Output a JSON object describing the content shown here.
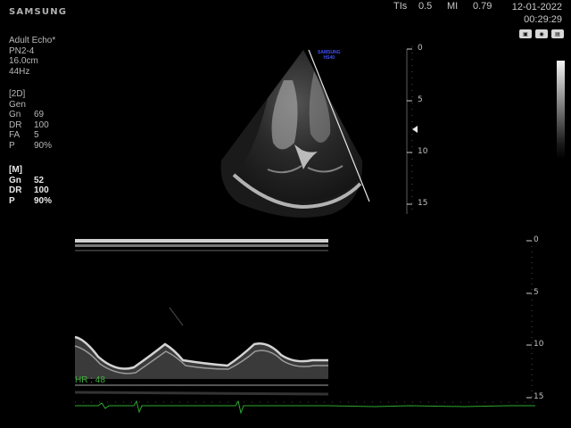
{
  "header": {
    "brand": "SAMSUNG",
    "tis_label": "TIs",
    "tis_value": "0.5",
    "mi_label": "MI",
    "mi_value": "0.79",
    "date": "12-01-2022",
    "time": "00:29:29"
  },
  "exam": {
    "preset": "Adult Echo*",
    "probe": "PN2-4",
    "depth": "16.0cm",
    "frame_rate": "44Hz"
  },
  "mode_2d": {
    "title": "[2D]",
    "mode": "Gen",
    "params": [
      {
        "k": "Gn",
        "v": "69"
      },
      {
        "k": "DR",
        "v": "100"
      },
      {
        "k": "FA",
        "v": "5"
      },
      {
        "k": "P",
        "v": "90%"
      }
    ]
  },
  "mode_m": {
    "title": "[M]",
    "params": [
      {
        "k": "Gn",
        "v": "52"
      },
      {
        "k": "DR",
        "v": "100"
      },
      {
        "k": "P",
        "v": "90%"
      }
    ]
  },
  "image_marker": {
    "line1": "SAMSUNG",
    "line2": "HS40"
  },
  "depth_scale_2d": [
    "0",
    "5",
    "10",
    "15"
  ],
  "depth_scale_m": [
    "0",
    "5",
    "10",
    "15"
  ],
  "heart_rate": "HR : 48",
  "icons": [
    "printer-icon",
    "probe-icon",
    "keyboard-icon"
  ],
  "colors": {
    "background": "#000000",
    "text": "#c8c8c8",
    "hr_green": "#3fb23f",
    "marker_blue": "#4050ff"
  }
}
